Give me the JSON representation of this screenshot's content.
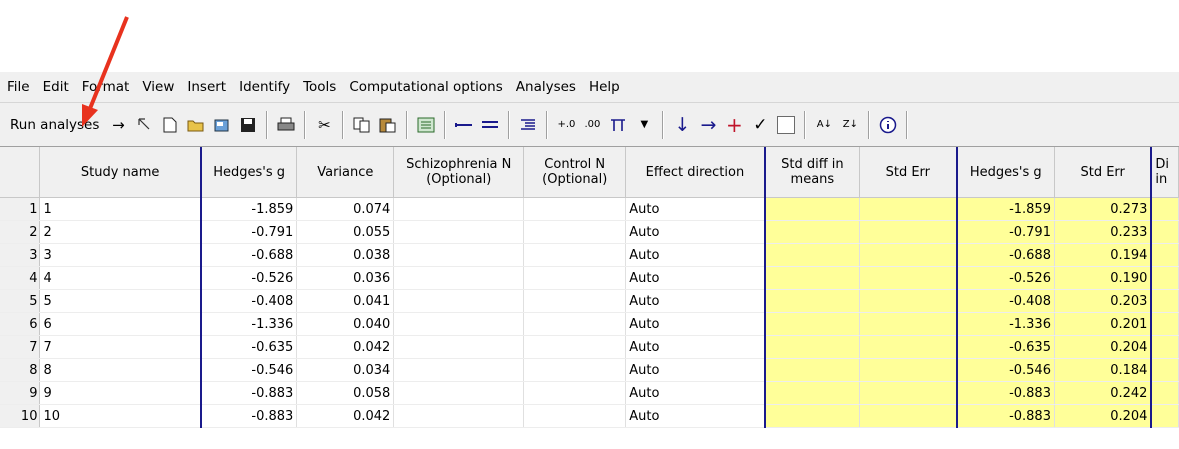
{
  "menu": [
    "File",
    "Edit",
    "Format",
    "View",
    "Insert",
    "Identify",
    "Tools",
    "Computational options",
    "Analyses",
    "Help"
  ],
  "toolbar": {
    "run_label": "Run analyses"
  },
  "columns": [
    "Study name",
    "Hedges's g",
    "Variance",
    "Schizophrenia N (Optional)",
    "Control N (Optional)",
    "Effect direction",
    "Std diff in means",
    "Std Err",
    "Hedges's g",
    "Std Err",
    "Di in"
  ],
  "rows": [
    {
      "n": "1",
      "study": "1",
      "g": "-1.859",
      "var": "0.074",
      "dir": "Auto",
      "g2": "-1.859",
      "se2": "0.273"
    },
    {
      "n": "2",
      "study": "2",
      "g": "-0.791",
      "var": "0.055",
      "dir": "Auto",
      "g2": "-0.791",
      "se2": "0.233"
    },
    {
      "n": "3",
      "study": "3",
      "g": "-0.688",
      "var": "0.038",
      "dir": "Auto",
      "g2": "-0.688",
      "se2": "0.194"
    },
    {
      "n": "4",
      "study": "4",
      "g": "-0.526",
      "var": "0.036",
      "dir": "Auto",
      "g2": "-0.526",
      "se2": "0.190"
    },
    {
      "n": "5",
      "study": "5",
      "g": "-0.408",
      "var": "0.041",
      "dir": "Auto",
      "g2": "-0.408",
      "se2": "0.203"
    },
    {
      "n": "6",
      "study": "6",
      "g": "-1.336",
      "var": "0.040",
      "dir": "Auto",
      "g2": "-1.336",
      "se2": "0.201"
    },
    {
      "n": "7",
      "study": "7",
      "g": "-0.635",
      "var": "0.042",
      "dir": "Auto",
      "g2": "-0.635",
      "se2": "0.204"
    },
    {
      "n": "8",
      "study": "8",
      "g": "-0.546",
      "var": "0.034",
      "dir": "Auto",
      "g2": "-0.546",
      "se2": "0.184"
    },
    {
      "n": "9",
      "study": "9",
      "g": "-0.883",
      "var": "0.058",
      "dir": "Auto",
      "g2": "-0.883",
      "se2": "0.242"
    },
    {
      "n": "10",
      "study": "10",
      "g": "-0.883",
      "var": "0.042",
      "dir": "Auto",
      "g2": "-0.883",
      "se2": "0.204"
    }
  ],
  "colors": {
    "highlight": "#ffff99",
    "arrow": "#e8321e",
    "divider": "#1a1a8c"
  }
}
